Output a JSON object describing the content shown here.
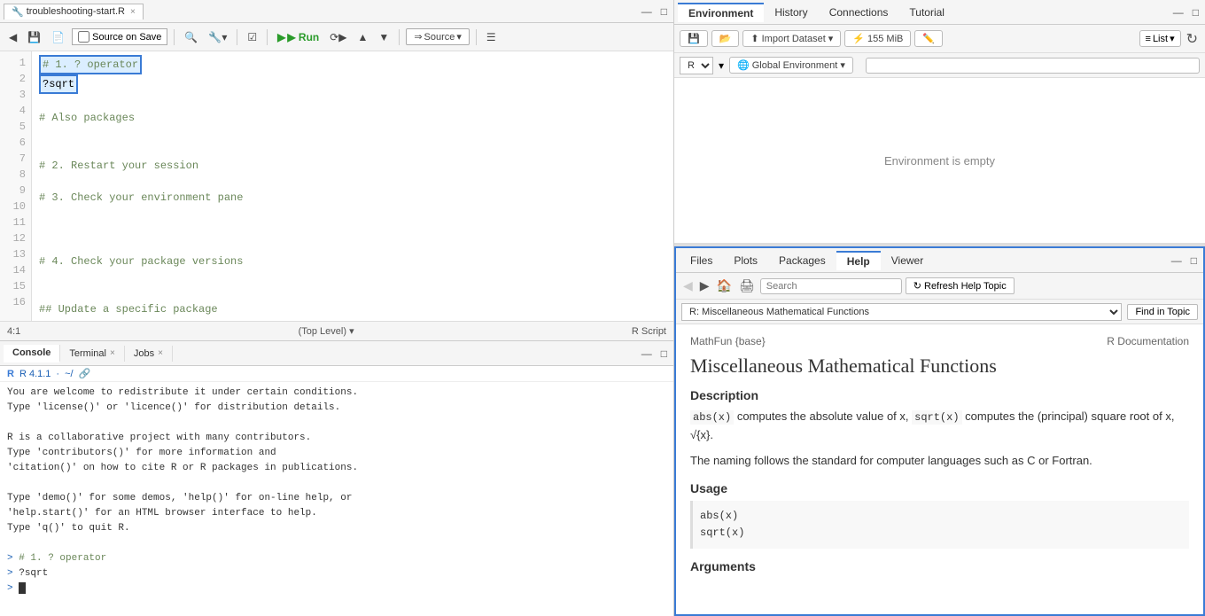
{
  "editor": {
    "tab_label": "troubleshooting-start.R",
    "tab_close": "×",
    "source_on_save_label": "Source on Save",
    "run_btn": "▶ Run",
    "source_btn": "Source",
    "status_left": "4:1",
    "status_right": "(Top Level)",
    "status_script": "R Script",
    "lines": [
      {
        "num": "1",
        "content": "# 1. ? operator",
        "type": "highlight"
      },
      {
        "num": "2",
        "content": "?sqrt",
        "type": "highlight"
      },
      {
        "num": "3",
        "content": ""
      },
      {
        "num": "4",
        "content": "# Also packages",
        "type": "comment"
      },
      {
        "num": "5",
        "content": ""
      },
      {
        "num": "6",
        "content": ""
      },
      {
        "num": "7",
        "content": "# 2. Restart your session",
        "type": "comment"
      },
      {
        "num": "8",
        "content": ""
      },
      {
        "num": "9",
        "content": "# 3. Check your environment pane",
        "type": "comment"
      },
      {
        "num": "10",
        "content": ""
      },
      {
        "num": "11",
        "content": ""
      },
      {
        "num": "12",
        "content": ""
      },
      {
        "num": "13",
        "content": "# 4. Check your package versions",
        "type": "comment"
      },
      {
        "num": "14",
        "content": ""
      },
      {
        "num": "15",
        "content": ""
      },
      {
        "num": "16",
        "content": "## Update a specific package",
        "type": "comment2"
      }
    ]
  },
  "console": {
    "tabs": [
      "Console",
      "Terminal",
      "Jobs"
    ],
    "r_version": "R 4.1.1",
    "r_path": "~/",
    "content": [
      "You are welcome to redistribute it under certain conditions.",
      "Type 'license()' or 'licence()' for distribution details.",
      "",
      "R is a collaborative project with many contributors.",
      "Type 'contributors()' for more information and",
      "'citation()' on how to cite R or R packages in publications.",
      "",
      "Type 'demo()' for some demos, 'help()' for on-line help, or",
      "'help.start()' for an HTML browser interface to help.",
      "Type 'q()' to quit R."
    ],
    "prompt_lines": [
      {
        "prompt": ">",
        "code": " # 1. ? operator",
        "type": "comment"
      },
      {
        "prompt": ">",
        "code": " ?sqrt",
        "type": "normal"
      },
      {
        "prompt": ">",
        "code": " ",
        "type": "cursor"
      }
    ]
  },
  "environment": {
    "tabs": [
      "Environment",
      "History",
      "Connections",
      "Tutorial"
    ],
    "active_tab": "Environment",
    "toolbar": {
      "import_dataset": "Import Dataset",
      "memory": "155 MiB",
      "list_btn": "List",
      "global_env": "Global Environment"
    },
    "r_version": "R",
    "empty_text": "Environment is empty"
  },
  "help": {
    "tabs": [
      "Files",
      "Plots",
      "Packages",
      "Help",
      "Viewer"
    ],
    "active_tab": "Help",
    "search_placeholder": "Search",
    "refresh_btn": "Refresh Help Topic",
    "topic_select": "R: Miscellaneous Mathematical Functions",
    "find_topic_btn": "Find in Topic",
    "content": {
      "meta_left": "MathFun {base}",
      "meta_right": "R Documentation",
      "title": "Miscellaneous Mathematical Functions",
      "description_title": "Description",
      "description": "abs(x) computes the absolute value of x, sqrt(x) computes the (principal) square root of x, √{x}.",
      "description2": "The naming follows the standard for computer languages such as C or Fortran.",
      "usage_title": "Usage",
      "usage_code": "abs(x)\nsqrt(x)",
      "arguments_title": "Arguments"
    }
  }
}
